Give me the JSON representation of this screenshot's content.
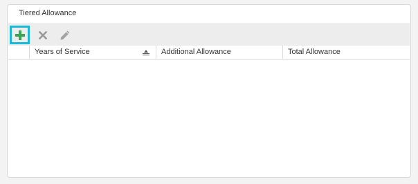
{
  "panel": {
    "title": "Tiered Allowance"
  },
  "toolbar": {
    "buttons": [
      {
        "icon": "plus-icon",
        "color": "#3aa655"
      },
      {
        "icon": "close-icon",
        "color": "#9a9a9a"
      },
      {
        "icon": "pencil-icon",
        "color": "#9a9a9a"
      }
    ]
  },
  "grid": {
    "columns": [
      {
        "label": "Years of Service",
        "sort": "ascending"
      },
      {
        "label": "Additional Allowance"
      },
      {
        "label": "Total Allowance"
      }
    ],
    "rows": []
  },
  "colors": {
    "focus_outline": "#19b8d6",
    "add_icon": "#3aa655",
    "disabled_icon": "#9a9a9a"
  }
}
